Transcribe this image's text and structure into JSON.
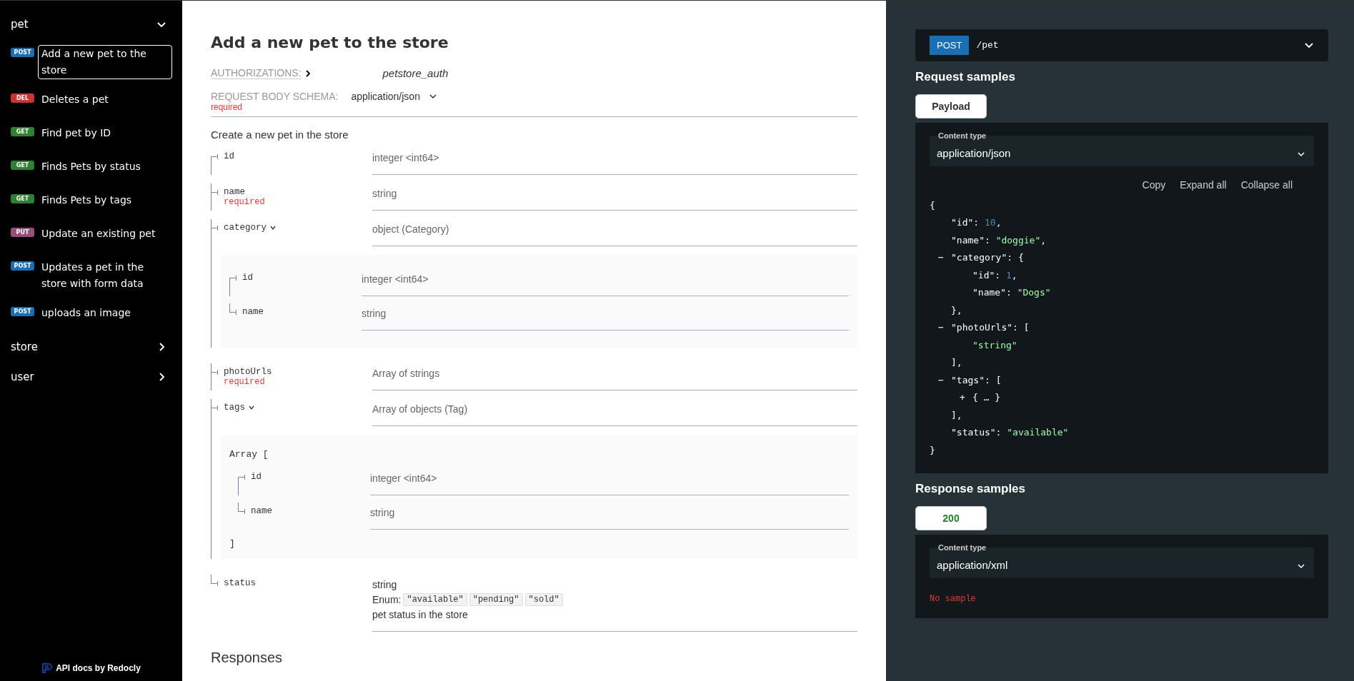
{
  "sidebar": {
    "groups": [
      {
        "name": "pet",
        "expanded": true,
        "items": [
          {
            "method": "POST",
            "color": "#186fb5",
            "label": "Add a new pet to the store",
            "selected": true
          },
          {
            "method": "DEL",
            "color": "#cc3333",
            "label": "Deletes a pet",
            "selected": false
          },
          {
            "method": "GET",
            "color": "#2f8132",
            "label": "Find pet by ID",
            "selected": false
          },
          {
            "method": "GET",
            "color": "#2f8132",
            "label": "Finds Pets by status",
            "selected": false
          },
          {
            "method": "GET",
            "color": "#2f8132",
            "label": "Finds Pets by tags",
            "selected": false
          },
          {
            "method": "PUT",
            "color": "#95507c",
            "label": "Update an existing pet",
            "selected": false
          },
          {
            "method": "POST",
            "color": "#186fb5",
            "label": "Updates a pet in the store with form data",
            "selected": false
          },
          {
            "method": "POST",
            "color": "#186fb5",
            "label": "uploads an image",
            "selected": false
          }
        ]
      },
      {
        "name": "store",
        "expanded": false
      },
      {
        "name": "user",
        "expanded": false
      }
    ],
    "footer": "API docs by Redocly"
  },
  "operation": {
    "title": "Add a new pet to the store",
    "authorizations": {
      "label": "AUTHORIZATIONS:",
      "value": "petstore_auth"
    },
    "request_body": {
      "label": "REQUEST BODY SCHEMA:",
      "content_type": "application/json",
      "required_label": "required"
    },
    "description": "Create a new pet in the store",
    "fields": [
      {
        "name": "id",
        "type": "integer <int64>"
      },
      {
        "name": "name",
        "required_label": "required",
        "type": "string"
      },
      {
        "name": "category",
        "type": "object (Category)",
        "expanded": true,
        "children": [
          {
            "name": "id",
            "type": "integer <int64>"
          },
          {
            "name": "name",
            "type": "string"
          }
        ]
      },
      {
        "name": "photoUrls",
        "required_label": "required",
        "type": "Array of strings"
      },
      {
        "name": "tags",
        "type": "Array of objects (Tag)",
        "expanded": true,
        "array_open": "Array [",
        "array_close": "]",
        "children": [
          {
            "name": "id",
            "type": "integer <int64>"
          },
          {
            "name": "name",
            "type": "string"
          }
        ]
      },
      {
        "name": "status",
        "type": "string",
        "enum": {
          "label": "Enum:",
          "values": [
            "\"available\"",
            "\"pending\"",
            "\"sold\""
          ]
        },
        "description": "pet status in the store"
      }
    ],
    "responses_title": "Responses"
  },
  "samples": {
    "endpoint": {
      "method": "POST",
      "color": "#186fb5",
      "path": "/pet"
    },
    "request": {
      "title": "Request samples",
      "tabs": [
        {
          "label": "Payload",
          "selected": true
        }
      ],
      "content_type_label": "Content type",
      "content_type": "application/json",
      "actions": [
        "Copy",
        "Expand all",
        "Collapse all"
      ],
      "body": {
        "open": "{",
        "close": "}",
        "children": [
          {
            "key": "\"id\": ",
            "value": "10",
            "kind": "number",
            "tail": ","
          },
          {
            "key": "\"name\": ",
            "value": "\"doggie\"",
            "kind": "string",
            "tail": ","
          },
          {
            "toggle": "−",
            "key": "\"category\": ",
            "open": "{",
            "close": "},",
            "children": [
              {
                "key": "\"id\": ",
                "value": "1",
                "kind": "number",
                "tail": ","
              },
              {
                "key": "\"name\": ",
                "value": "\"Dogs\"",
                "kind": "string"
              }
            ]
          },
          {
            "toggle": "−",
            "key": "\"photoUrls\": ",
            "open": "[",
            "close": "],",
            "children": [
              {
                "value": "\"string\"",
                "kind": "string"
              }
            ]
          },
          {
            "toggle": "−",
            "key": "\"tags\": ",
            "open": "[",
            "close": "],",
            "children": [
              {
                "toggle": "+",
                "collapsed": "{ … }"
              }
            ]
          },
          {
            "key": "\"status\": ",
            "value": "\"available\"",
            "kind": "string"
          }
        ]
      }
    },
    "response": {
      "title": "Response samples",
      "tabs": [
        {
          "label": "200",
          "selected": true
        }
      ],
      "content_type_label": "Content type",
      "content_type": "application/xml",
      "empty": "No sample"
    }
  }
}
